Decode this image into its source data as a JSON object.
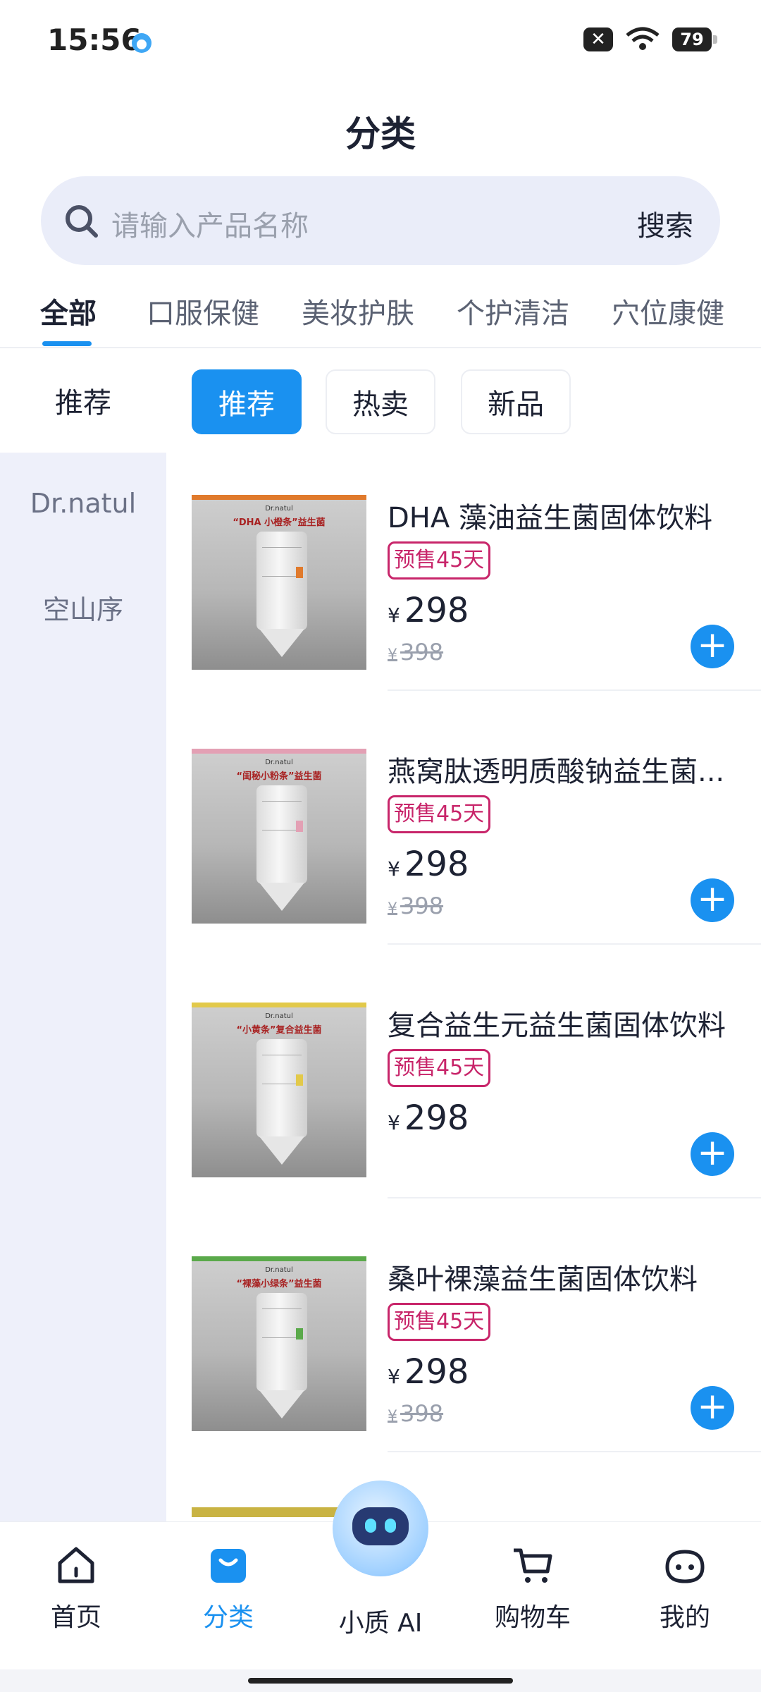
{
  "status": {
    "time": "15:56",
    "battery": "79"
  },
  "header": {
    "title": "分类"
  },
  "search": {
    "placeholder": "请输入产品名称",
    "button": "搜索"
  },
  "tabs": [
    "全部",
    "口服保健",
    "美妆护肤",
    "个护清洁",
    "穴位康健"
  ],
  "left_header": "推荐",
  "sidebar": [
    "Dr.natul",
    "空山序"
  ],
  "filters": [
    "推荐",
    "热卖",
    "新品"
  ],
  "products": [
    {
      "name": "DHA 藻油益生菌固体饮料",
      "badge": "预售45天",
      "currency": "¥",
      "price": "298",
      "old_price": "398",
      "band_color": "#e07a2c",
      "img_brand": "Dr.natul",
      "img_title": "“DHA 小橙条”益生菌"
    },
    {
      "name": "燕窝肽透明质酸钠益生菌...",
      "badge": "预售45天",
      "currency": "¥",
      "price": "298",
      "old_price": "398",
      "band_color": "#e3a0b4",
      "img_brand": "Dr.natul",
      "img_title": "“闺秘小粉条”益生菌"
    },
    {
      "name": "复合益生元益生菌固体饮料",
      "badge": "预售45天",
      "currency": "¥",
      "price": "298",
      "old_price": "",
      "band_color": "#e2c94a",
      "img_brand": "Dr.natul",
      "img_title": "“小黄条”复合益生菌"
    },
    {
      "name": "桑叶裸藻益生菌固体饮料",
      "badge": "预售45天",
      "currency": "¥",
      "price": "298",
      "old_price": "398",
      "band_color": "#5aa94a",
      "img_brand": "Dr.natul",
      "img_title": "“裸藻小绿条”益生菌"
    }
  ],
  "bottom_nav": [
    {
      "label": "首页",
      "icon": "home-icon"
    },
    {
      "label": "分类",
      "icon": "bag-icon"
    },
    {
      "label": "小质 AI",
      "icon": "robot-avatar"
    },
    {
      "label": "购物车",
      "icon": "cart-icon"
    },
    {
      "label": "我的",
      "icon": "profile-icon"
    }
  ],
  "colors": {
    "accent": "#1a91f0",
    "badge": "#c8256a",
    "sidebar_bg": "#eef0fa"
  }
}
